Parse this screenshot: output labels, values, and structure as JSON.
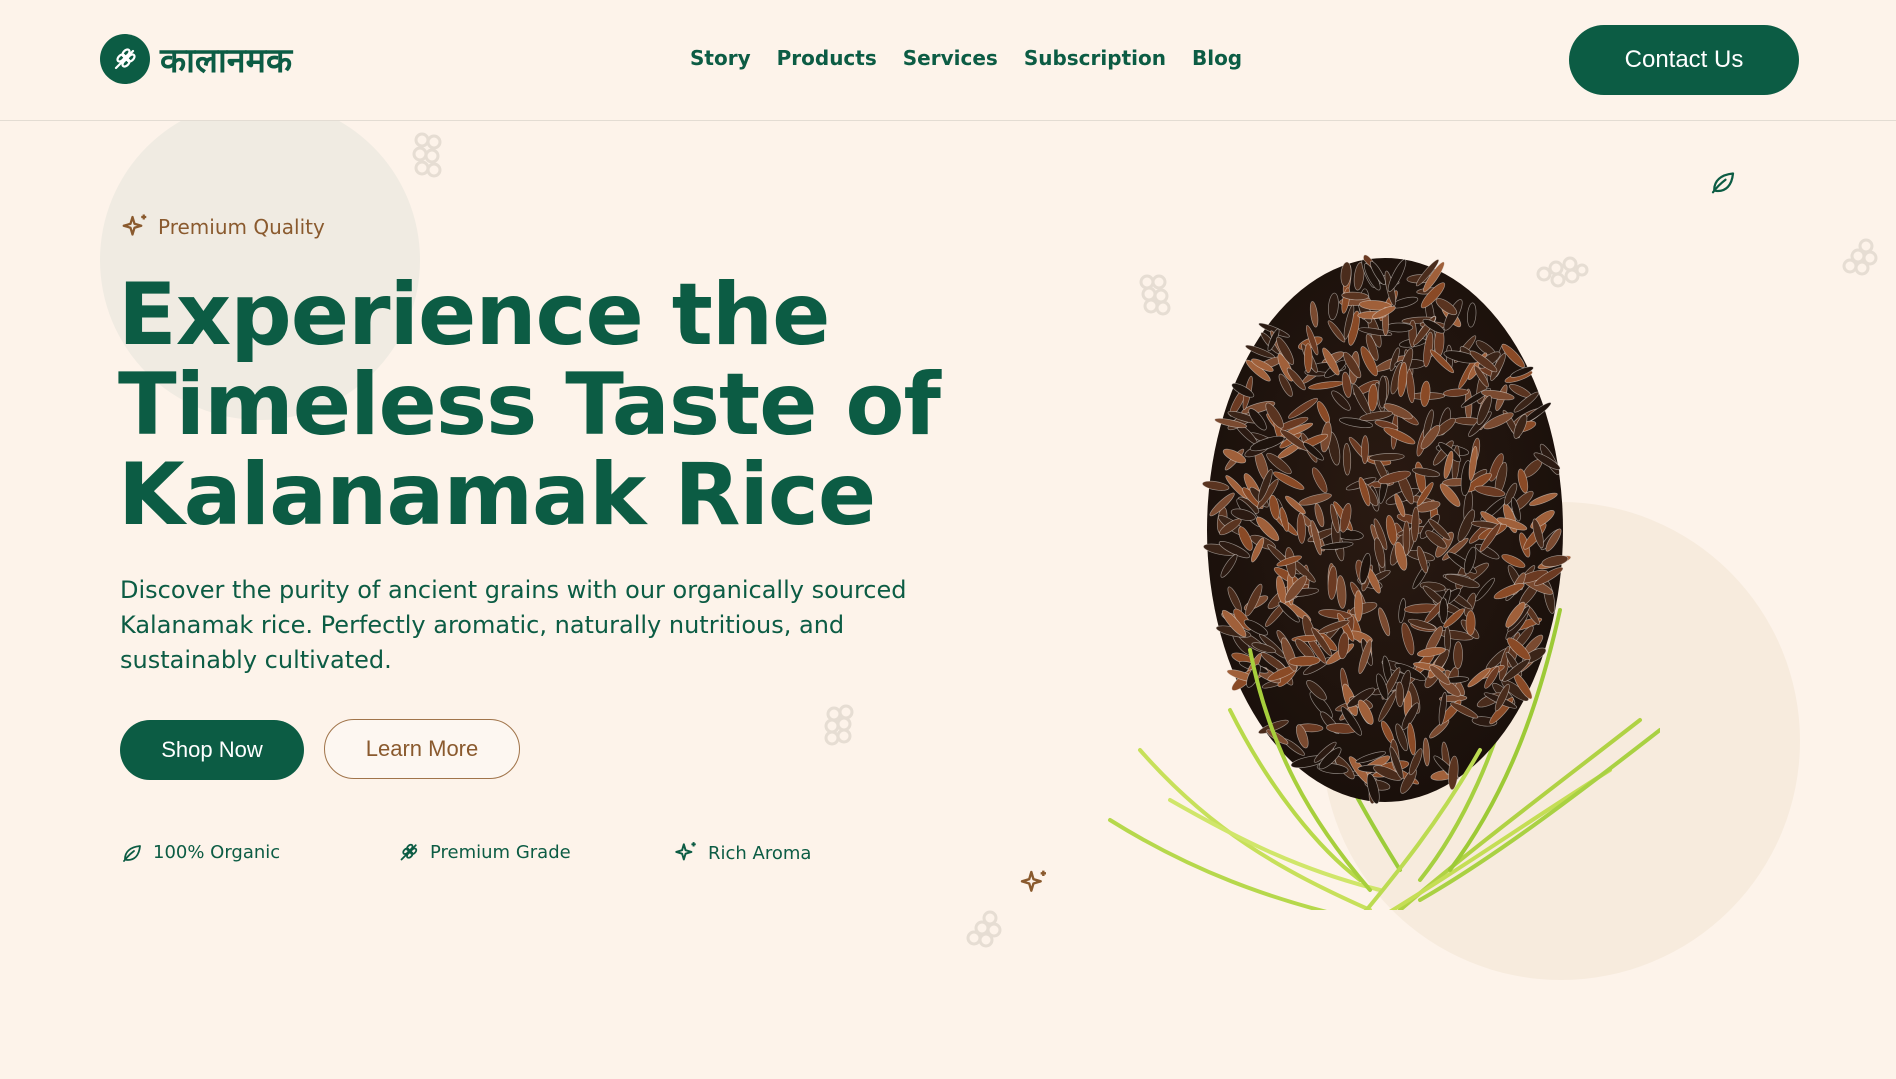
{
  "header": {
    "logo_text": "कालानमक",
    "logo_icon": "wheat-icon",
    "nav": [
      "Story",
      "Products",
      "Services",
      "Subscription",
      "Blog"
    ],
    "contact_label": "Contact Us"
  },
  "hero": {
    "badge_icon": "sparkle-icon",
    "badge_text": "Premium Quality",
    "headline_lines": [
      "Experience the",
      "Timeless Taste of",
      "Kalanamak Rice"
    ],
    "description_lines": [
      "Discover the purity of ancient grains with our organically sourced",
      "Kalanamak rice. Perfectly aromatic, naturally nutritious, and",
      "sustainably cultivated."
    ],
    "shop_label": "Shop Now",
    "learn_label": "Learn More",
    "features": [
      {
        "icon": "leaf-icon",
        "label": "100% Organic"
      },
      {
        "icon": "wheat-icon",
        "label": "Premium Grade"
      },
      {
        "icon": "sparkle-icon",
        "label": "Rich Aroma"
      }
    ]
  },
  "colors": {
    "brand": "#0c5c44",
    "accent": "#8a5a2e",
    "background": "#fdf3ea"
  }
}
